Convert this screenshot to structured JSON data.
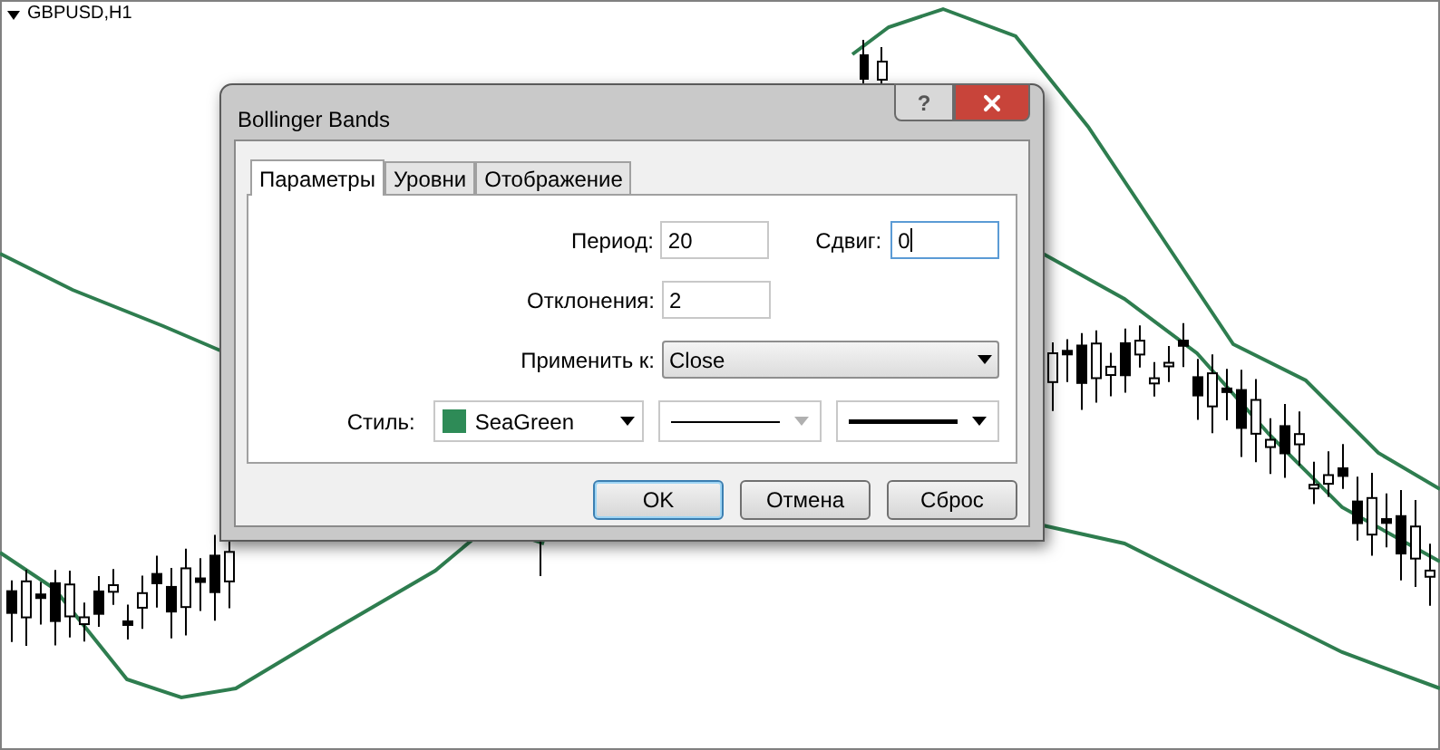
{
  "chart": {
    "title": "GBPUSD,H1"
  },
  "dialog": {
    "title": "Bollinger Bands",
    "help": "?",
    "tabs": [
      {
        "label": "Параметры",
        "selected": true
      },
      {
        "label": "Уровни",
        "selected": false
      },
      {
        "label": "Отображение",
        "selected": false
      }
    ],
    "fields": [
      {
        "label": "Период:",
        "value": "20",
        "focused": false
      },
      {
        "label": "Сдвиг:",
        "value": "0",
        "focused": true
      },
      {
        "label": "Отклонения:",
        "value": "2",
        "focused": false
      }
    ],
    "apply_to": {
      "label": "Применить к:",
      "value": "Close"
    },
    "style": {
      "label": "Стиль:",
      "color": "#2e8b57",
      "color_name": "SeaGreen"
    },
    "line_dropdowns": [
      {
        "kind": "style",
        "disabled": true
      },
      {
        "kind": "width",
        "disabled": false
      }
    ],
    "buttons": [
      {
        "label": "OK",
        "default": true
      },
      {
        "label": "Отмена",
        "default": false
      },
      {
        "label": "Сброс",
        "default": false
      }
    ]
  }
}
